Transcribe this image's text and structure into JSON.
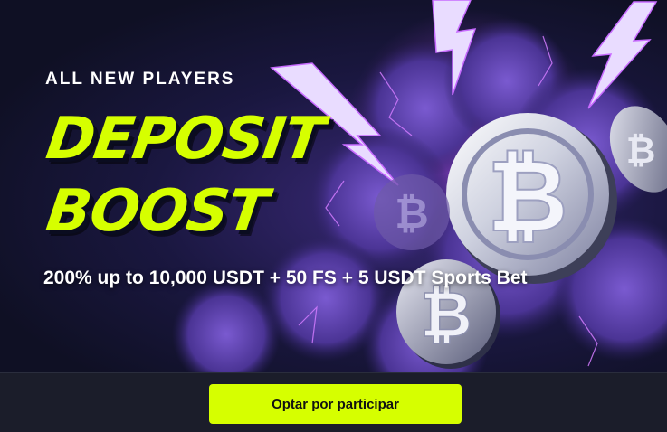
{
  "promo": {
    "eyebrow": "ALL NEW PLAYERS",
    "headline_line1": "DEPOSIT",
    "headline_line2": "BOOST",
    "offer_text": "200% up to 10,000 USDT + 50 FS + 5 USDT Sports Bet",
    "art": {
      "coin_symbol": "₿",
      "icons": [
        "bitcoin-coin-icon",
        "lightning-bolt-icon"
      ]
    }
  },
  "footer": {
    "cta_label": "Optar por participar"
  },
  "colors": {
    "accent": "#d6ff00",
    "background": "#1b1d2a",
    "banner_dark": "#0f1024",
    "cloud_purple": "#5b3fa8",
    "lightning": "#c86bff"
  }
}
